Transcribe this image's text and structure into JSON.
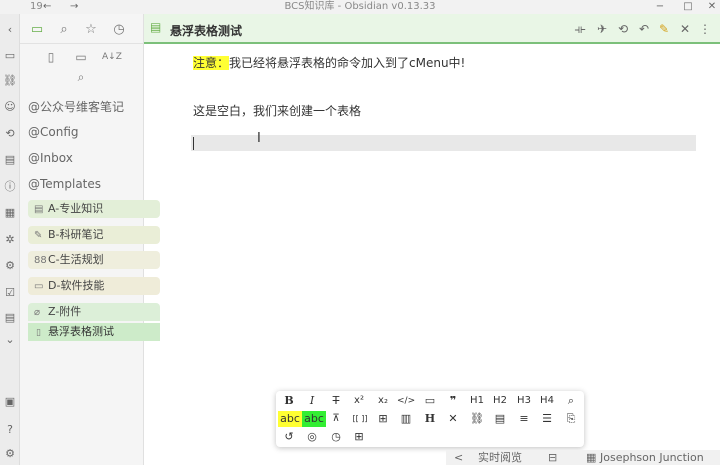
{
  "titlebar": {
    "title": "BCS知识库 - Obsidian v0.13.33",
    "counter": "19",
    "back": "←",
    "forward": "→",
    "minimize": "−",
    "maximize": "□",
    "close": "✕"
  },
  "ribbon": {
    "collapse": "‹",
    "icons": [
      "▭",
      "⛓",
      "☺",
      "⟲",
      "▤",
      "ⓘ",
      "▦",
      "✲",
      "⚙",
      "☑",
      "▤",
      "⌄"
    ],
    "bottom": [
      "▣",
      "?",
      "⚙"
    ]
  },
  "sidebar": {
    "top_icons": [
      "▭",
      "⌕",
      "☆",
      "◷"
    ],
    "file_tools": [
      "▯",
      "▭",
      "↕",
      "⌕"
    ],
    "sort_label": "A↓Z",
    "items": [
      "@公众号维客笔记",
      "@Config",
      "@Inbox",
      "@Templates"
    ],
    "folders": [
      {
        "label": "A-专业知识",
        "icon": "▤",
        "color": "#e3efd8"
      },
      {
        "label": "B-科研笔记",
        "icon": "✎",
        "color": "#eaeed7"
      },
      {
        "label": "C-生活规划",
        "icon": "88",
        "color": "#efeedd"
      },
      {
        "label": "D-软件技能",
        "icon": "▭",
        "color": "#efecd9"
      },
      {
        "label": "Z-附件",
        "icon": "⌀",
        "color": "#dcefd8"
      }
    ],
    "active_file": {
      "label": "悬浮表格测试",
      "icon": "▯"
    }
  },
  "editor": {
    "tab_title": "悬浮表格测试",
    "actions": [
      "⟛",
      "✈",
      "⟲",
      "↶",
      "✎",
      "✕",
      "⋮"
    ],
    "line1_highlight": "注意：",
    "line1_rest": "我已经将悬浮表格的命令加入到了cMenu中!",
    "line2": "这是空白，我们来创建一个表格",
    "ibeam": "I"
  },
  "floatbar": {
    "row1": [
      "B",
      "I",
      "T",
      "x²",
      "x₂",
      "</>",
      "▭",
      "❞",
      "H1",
      "H2",
      "H3",
      "H4",
      "⌕"
    ],
    "row2_highlights": [
      "abc",
      "abc"
    ],
    "row2": [
      "⊼",
      "[[ ]]",
      "⊞",
      "▥",
      "H",
      "✕",
      "⛓",
      "▤",
      "≡",
      "☰",
      "⎘"
    ],
    "row3": [
      "↺",
      "◎",
      "◷",
      "⊞"
    ]
  },
  "statusbar": {
    "chevron": "<",
    "reading": "实时阅览",
    "icon": "⊟",
    "palette_icon": "▦",
    "theme": "Josephson Junction"
  }
}
